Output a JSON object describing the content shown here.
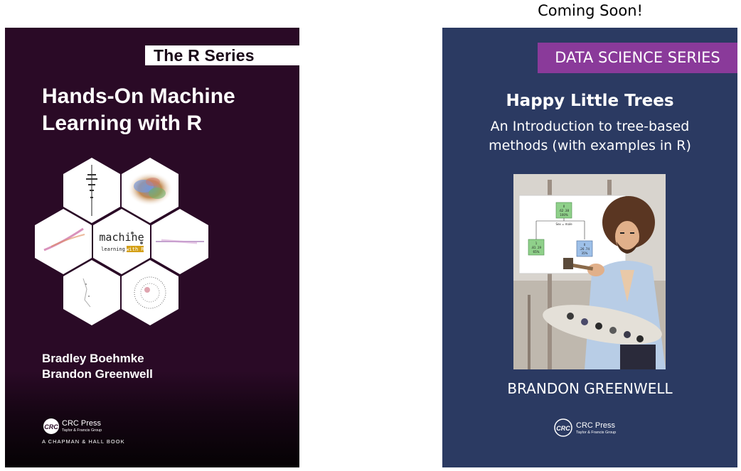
{
  "coming_soon": "Coming Soon!",
  "book1": {
    "series": "The R Series",
    "title_line1": "Hands-On Machine",
    "title_line2": "Learning with R",
    "hex_center_word1": "machine",
    "hex_center_word2": "learning",
    "hex_center_word3": "with R",
    "author1": "Bradley Boehmke",
    "author2": "Brandon Greenwell",
    "publisher": "CRC Press",
    "publisher_group": "Taylor & Francis Group",
    "imprint": "A CHAPMAN & HALL BOOK",
    "colors": {
      "background": "#2a0a26",
      "series_bg": "#ffffff"
    }
  },
  "book2": {
    "series": "DATA SCIENCE SERIES",
    "title": "Happy Little Trees",
    "subtitle_line1": "An Introduction to tree-based",
    "subtitle_line2": "methods (with examples in R)",
    "author": "BRANDON GREENWELL",
    "publisher": "CRC Press",
    "publisher_group": "Taylor & Francis Group",
    "tree_root_value": "0",
    "tree_root_stats": ".62 .38",
    "tree_root_pct": "100%",
    "tree_split": "Sex = male",
    "tree_left_value": "1",
    "tree_left_stats": ".81 .19",
    "tree_left_pct": "65%",
    "tree_right_value": "0",
    "tree_right_stats": ".26 .74",
    "tree_right_pct": "35%",
    "colors": {
      "background": "#2b3a62",
      "series_bg": "#8a3a9a"
    }
  }
}
